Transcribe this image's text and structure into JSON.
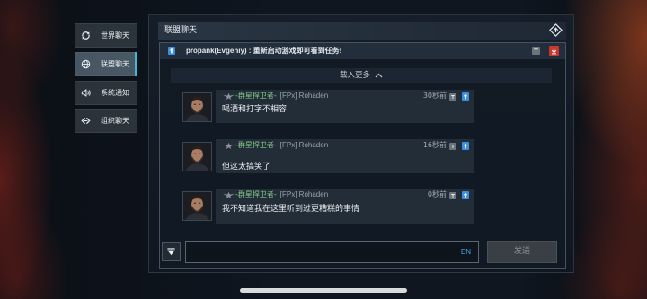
{
  "sidebar": {
    "items": [
      {
        "label": "世界聊天",
        "icon": "refresh-icon",
        "active": false
      },
      {
        "label": "联盟聊天",
        "icon": "globe-icon",
        "active": true
      },
      {
        "label": "系统通知",
        "icon": "speaker-icon",
        "active": false
      },
      {
        "label": "组织聊天",
        "icon": "chevrons-icon",
        "active": false
      }
    ]
  },
  "header": {
    "title": "联盟聊天",
    "action_icon": "diamond-icon"
  },
  "pinned": {
    "text": "propank(Evgeniy) : 重新启动游戏即可看到任务!",
    "left_icon": "pin-icon",
    "right_icons": [
      "translate-icon",
      "arrow-down-icon"
    ]
  },
  "load_more": {
    "label": "载入更多",
    "icon": "chevron-up-icon"
  },
  "messages": [
    {
      "corp": "-群星捍卫者-",
      "player": "[FPx] Rohaden",
      "time": "30秒前",
      "text": "喝酒和打字不相容"
    },
    {
      "corp": "-群星捍卫者-",
      "player": "[FPx] Rohaden",
      "time": "16秒前",
      "text": "但这太搞笑了"
    },
    {
      "corp": "-群星捍卫者-",
      "player": "[FPx] Rohaden",
      "time": "0秒前",
      "text": "我不知道我在这里听到过更糟糕的事情"
    }
  ],
  "message_icons": [
    "corp-emblem-icon",
    "translate-icon",
    "pin-icon"
  ],
  "input": {
    "value": "",
    "language": "EN",
    "filter_icon": "filter-icon"
  },
  "send_button": {
    "label": "发送"
  },
  "colors": {
    "accent": "#3fb8d4",
    "corp_name": "#86c98a",
    "player_name": "#9ba4ad",
    "language": "#4aa6e8",
    "pin": "#3b8fe0",
    "alert": "#c8372b"
  }
}
